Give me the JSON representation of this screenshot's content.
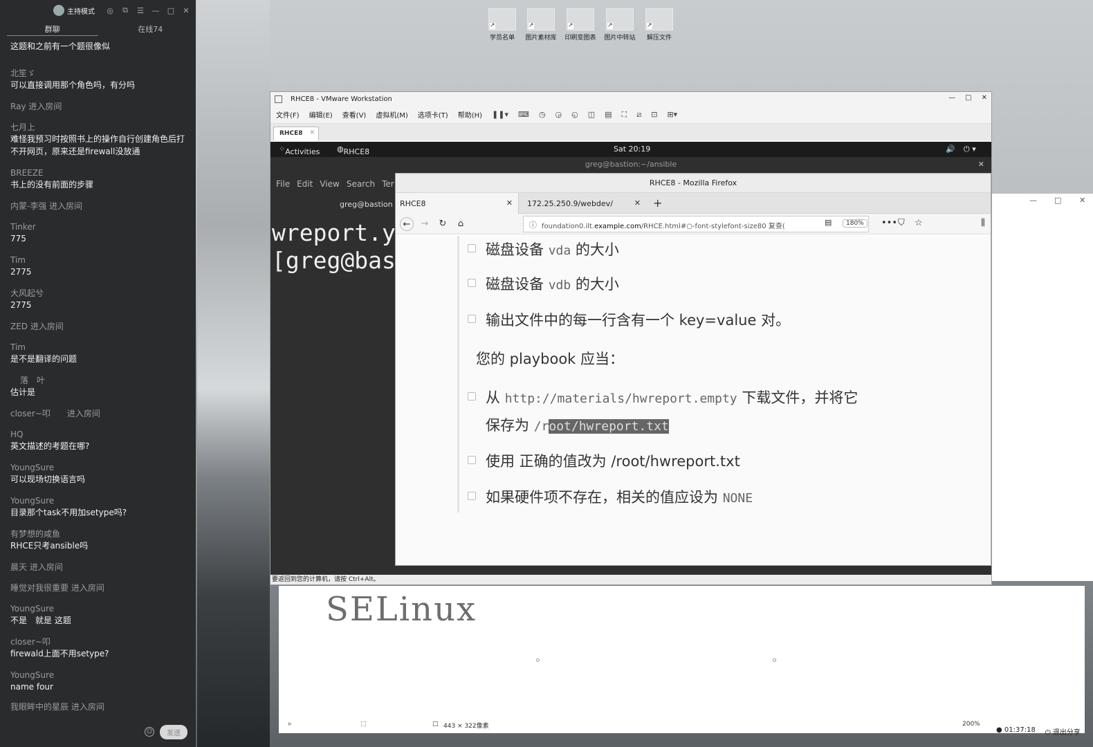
{
  "chat": {
    "host_mode": "主持模式",
    "tabs": [
      "群聊",
      "在线74"
    ],
    "messages": [
      {
        "user": "",
        "text": "这题和之前有一个题很像似"
      },
      {
        "user": "北笙ゞ",
        "text": "可以直接调用那个角色吗，有分吗"
      },
      {
        "user": "Ray 进入房间",
        "text": ""
      },
      {
        "user": "七月上",
        "text": "难怪我预习时按照书上的操作自行创建角色后打不开网页，原来还是firewall没放通"
      },
      {
        "user": "BREEZE",
        "text": "书上的没有前面的步骤"
      },
      {
        "user": "内蒙-李强 进入房间",
        "text": ""
      },
      {
        "user": "Tinker",
        "text": "775"
      },
      {
        "user": "Tim",
        "text": "2775"
      },
      {
        "user": "大风起兮",
        "text": "2775"
      },
      {
        "user": "ZED 进入房间",
        "text": ""
      },
      {
        "user": "Tim",
        "text": "是不是翻译的问题"
      },
      {
        "user": "落　叶",
        "text": "估计是"
      },
      {
        "user": "closer~叩　　进入房间",
        "text": ""
      },
      {
        "user": "HQ",
        "text": "英文描述的考题在哪?"
      },
      {
        "user": "YoungSure",
        "text": "可以现场切换语言吗"
      },
      {
        "user": "YoungSure",
        "text": "目录那个task不用加setype吗?"
      },
      {
        "user": "有梦想的咸鱼",
        "text": "RHCE只考ansible吗"
      },
      {
        "user": "晨天 进入房间",
        "text": ""
      },
      {
        "user": "睡觉对我很重要 进入房间",
        "text": ""
      },
      {
        "user": "YoungSure",
        "text": "不是　就是 这题"
      },
      {
        "user": "closer~叩",
        "text": "firewald上面不用setype?"
      },
      {
        "user": "YoungSure",
        "text": "name four"
      },
      {
        "user": "我眼眸中的星辰 进入房间",
        "text": ""
      }
    ],
    "send_label": "发送"
  },
  "desktop": {
    "icons": [
      "学员名单",
      "图片素材库",
      "印刷变图表",
      "图片中转站",
      "解压文件"
    ]
  },
  "vmware": {
    "title": "RHCE8 - VMware Workstation",
    "menus": [
      "文件(F)",
      "编辑(E)",
      "查看(V)",
      "虚拟机(M)",
      "选项卡(T)",
      "帮助(H)"
    ],
    "tab": "RHCE8",
    "status": "要返回到您的计算机，请按 Ctrl+Alt。"
  },
  "gnome": {
    "activities": "Activities",
    "app": "RHCE8 - Mozilla Firefox ▾",
    "clock": "Sat 20:19"
  },
  "terminal": {
    "title": "greg@bastion:~/ansible",
    "menus": [
      "File",
      "Edit",
      "View",
      "Search",
      "Ter"
    ],
    "tab": "greg@bastion",
    "line1": "wreport.y",
    "line2": "[greg@bas"
  },
  "firefox": {
    "title": "RHCE8 - Mozilla Firefox",
    "tabs": [
      "RHCE8",
      "172.25.250.9/webdev/"
    ],
    "url_prefix": "foundation0.ilt.",
    "url_domain": "example.com",
    "url_rest": "/RHCE.html#○-font-stylefont-size80 复查(",
    "zoom": "180%"
  },
  "doc": {
    "item1": {
      "a": "磁盘设备 ",
      "code": "vda",
      "b": " 的大小"
    },
    "item2": {
      "a": "磁盘设备 ",
      "code": "vdb",
      "b": " 的大小"
    },
    "item3": "输出文件中的每一行含有一个 key=value 对。",
    "para": "您的 playbook 应当：",
    "item4": {
      "a": "从 ",
      "code": "http://materials/hwreport.empty",
      "b": " 下载文件，并将它",
      "c": "保存为 ",
      "code2a": "/r",
      "code2b": "oot/hwreport.txt"
    },
    "item5": "使用 正确的值改为 /root/hwreport.txt",
    "item6": {
      "a": "如果硬件项不存在，相关的值应设为 ",
      "code": "NONE"
    }
  },
  "bgdialog": {
    "heading": "SELinux",
    "size": "443 × 322像素",
    "zoom": "200%"
  },
  "taskbar": {
    "time": "01:37:18",
    "exit_share": "退出分享"
  }
}
